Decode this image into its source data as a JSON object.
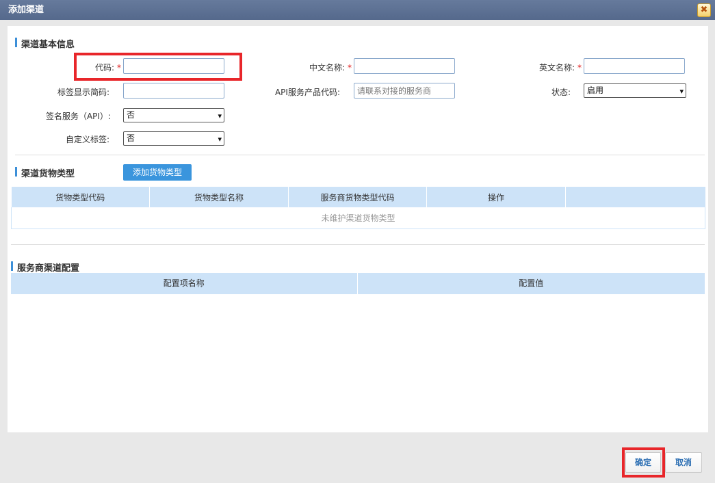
{
  "dialog": {
    "title": "添加渠道",
    "close_glyph": "✖"
  },
  "basic": {
    "section_title": "渠道基本信息",
    "code_label": "代码:",
    "code_value": "",
    "cn_name_label": "中文名称:",
    "cn_name_value": "",
    "en_name_label": "英文名称:",
    "en_name_value": "",
    "required_mark": "*",
    "short_code_label": "标签显示简码:",
    "short_code_value": "",
    "api_code_label": "API服务产品代码:",
    "api_code_placeholder": "请联系对接的服务商",
    "status_label": "状态:",
    "status_value": "启用",
    "sign_label": "签名服务（API）:",
    "sign_value": "否",
    "custom_label_label": "自定义标签:",
    "custom_label_value": "否"
  },
  "cargo": {
    "section_title": "渠道货物类型",
    "add_button": "添加货物类型",
    "columns": [
      "货物类型代码",
      "货物类型名称",
      "服务商货物类型代码",
      "操作",
      ""
    ],
    "empty_text": "未维护渠道货物类型"
  },
  "provider": {
    "section_title": "服务商渠道配置",
    "columns": [
      "配置项名称",
      "配置值"
    ]
  },
  "footer": {
    "confirm": "确定",
    "cancel": "取消"
  },
  "colors": {
    "title_bar": "#5d7194",
    "accent": "#3a95dd",
    "table_header": "#cde3f8",
    "highlight": "#e8262a"
  }
}
